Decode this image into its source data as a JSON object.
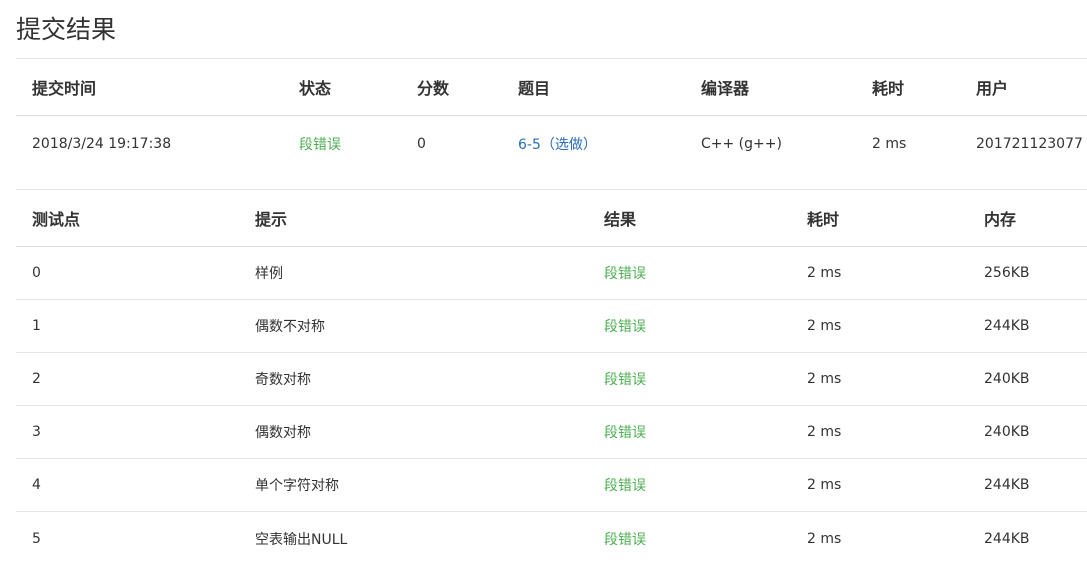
{
  "page": {
    "title": "提交结果"
  },
  "submission": {
    "headers": {
      "time": "提交时间",
      "status": "状态",
      "score": "分数",
      "problem": "题目",
      "compiler": "编译器",
      "duration": "耗时",
      "user": "用户"
    },
    "row": {
      "time": "2018/3/24 19:17:38",
      "status": "段错误",
      "score": "0",
      "problem": "6-5（选做）",
      "compiler": "C++ (g++)",
      "duration": "2 ms",
      "user": "201721123077"
    }
  },
  "testcases": {
    "headers": {
      "point": "测试点",
      "hint": "提示",
      "result": "结果",
      "duration": "耗时",
      "memory": "内存"
    },
    "rows": [
      {
        "point": "0",
        "hint": "样例",
        "result": "段错误",
        "duration": "2 ms",
        "memory": "256KB"
      },
      {
        "point": "1",
        "hint": "偶数不对称",
        "result": "段错误",
        "duration": "2 ms",
        "memory": "244KB"
      },
      {
        "point": "2",
        "hint": "奇数对称",
        "result": "段错误",
        "duration": "2 ms",
        "memory": "240KB"
      },
      {
        "point": "3",
        "hint": "偶数对称",
        "result": "段错误",
        "duration": "2 ms",
        "memory": "240KB"
      },
      {
        "point": "4",
        "hint": "单个字符对称",
        "result": "段错误",
        "duration": "2 ms",
        "memory": "244KB"
      },
      {
        "point": "5",
        "hint": "空表输出NULL",
        "result": "段错误",
        "duration": "2 ms",
        "memory": "244KB"
      }
    ]
  },
  "colors": {
    "status_error_text": "#4caf50",
    "link": "#2a6ebb",
    "border": "#e6e6e6"
  }
}
